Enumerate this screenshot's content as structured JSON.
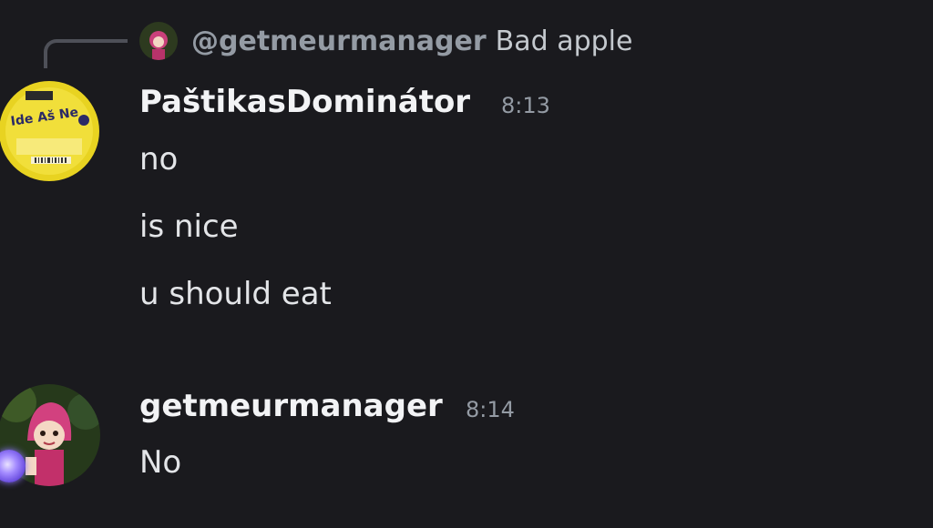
{
  "reply": {
    "mention": "@getmeurmanager",
    "text": "Bad apple"
  },
  "messages": [
    {
      "author": "PaštikasDominátor",
      "time": "8:13",
      "lines": [
        "no",
        "is nice",
        "u should eat"
      ],
      "avatar_icon": "pate-can-avatar"
    },
    {
      "author": "getmeurmanager",
      "time": "8:14",
      "lines": [
        "No"
      ],
      "avatar_icon": "cartoon-girl-avatar"
    }
  ],
  "colors": {
    "background": "#1a1a1e",
    "username": "#f2f3f5",
    "timestamp": "#949ba4",
    "message_text": "#e3e5e8",
    "reply_mention": "#949ba4"
  }
}
